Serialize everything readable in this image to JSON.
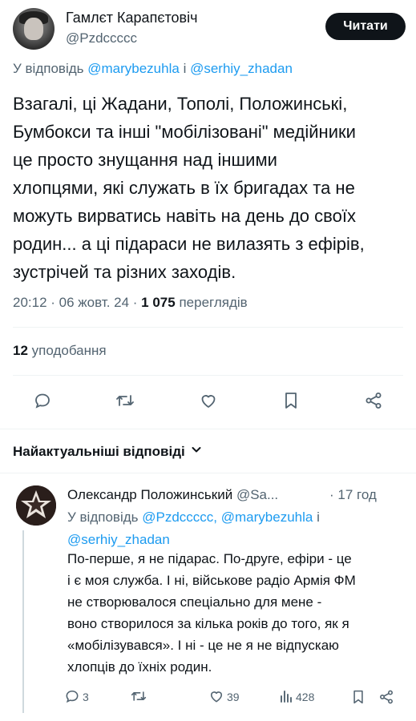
{
  "author": {
    "name": "Гамлєт Карапєтовіч",
    "handle": "@Pzdccccc",
    "follow_label": "Читати"
  },
  "tweet": {
    "reply_prefix": "У відповідь",
    "reply_mention_1": "@marybezuhla",
    "reply_and": "і",
    "reply_mention_2": "@serhiy_zhadan",
    "text_lines": [
      "Взагалі, ці Жадани, Тополі, Положинські,",
      "Бумбокси та інші \"мобілізовані\" медійники",
      "це просто знущання над іншими",
      "хлопцями, які служать в їх бригадах та не",
      "можуть вирватись навіть на день до своїх",
      "родин... а ці підараси не вилазять з ефірів,",
      "зустрічей та різних заходів."
    ],
    "time": "20:12",
    "date": "06 жовт. 24",
    "views_count": "1 075",
    "views_label": "переглядів",
    "likes_count": "12",
    "likes_label": "уподобання"
  },
  "actions": {
    "icons": [
      "reply-icon",
      "retweet-icon",
      "like-icon",
      "bookmark-icon",
      "share-icon"
    ]
  },
  "replies_section": {
    "heading": "Найактуальніші відповіді"
  },
  "reply": {
    "name": "Олександр Положинський",
    "handle": "@Sa...",
    "time": "· 17 год",
    "reply_prefix": "У відповідь",
    "mention_1": "@Pzdccccc,",
    "mention_2": "@marybezuhla",
    "mention_and": "і",
    "mention_3": "@serhiy_zhadan",
    "text_lines": [
      "По-перше, я не підарас. По-друге, ефіри - це",
      "і є моя служба. І ні, військове радіо Армія ФМ",
      "не створювалося спеціально для мене -",
      "воно створилося за кілька років до того, як я",
      "«мобілізувався». І ні - це не я не відпускаю",
      "хлопців до їхніх родин."
    ],
    "reply_count": "3",
    "retweet_count": "",
    "like_count": "39",
    "views_count": "428"
  }
}
